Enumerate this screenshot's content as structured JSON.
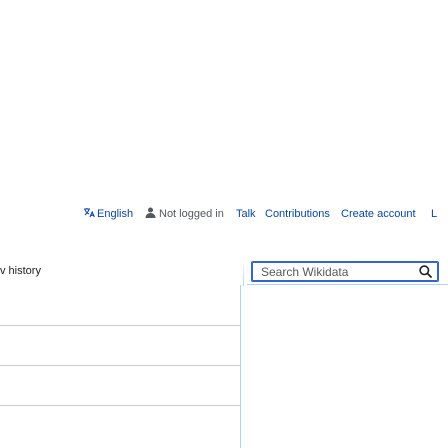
{
  "personal_tools": {
    "language": "English",
    "not_logged_in": "Not logged in",
    "talk": "Talk",
    "contributions": "Contributions",
    "create_account": "Create account",
    "log_in_partial": "L"
  },
  "search": {
    "placeholder": "Search Wikidata"
  },
  "tabs": {
    "history_partial": "v history"
  },
  "colors": {
    "link": "#0645ad",
    "accent": "#3366cc",
    "tab_border": "#a7d7f9"
  }
}
